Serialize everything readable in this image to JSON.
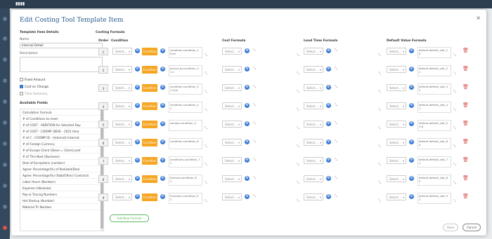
{
  "modal": {
    "title": "Edit Costing Tool Template Item",
    "close": "×",
    "footer": {
      "save": "Save",
      "cancel": "Cancel"
    }
  },
  "left": {
    "section_title": "Template Item Details",
    "name_label": "Name",
    "name_value": "Internal Detail",
    "description_label": "Description",
    "check1": "Fixed Amount",
    "check2": "Cost on Change",
    "check3": "Time Summary",
    "available_fields_title": "Available Fields",
    "fields": [
      "Calculation Formula",
      "# of Conditions to meet",
      "# of COST - ADDITION for Selected Day",
      "# of COST - COOMP. DEVE - 2021 time",
      "# of C - COOMP ID - (Internet) Internet",
      "# of Foreign Currency",
      "# of Europe Client (Slave = Client) prof",
      "# of This Next (Business)",
      "Deal of Exceptions (number)",
      "Agree: Percentage(%) of Realized/Deal",
      "Agree: Percentage(%) (Slab/Other) Contracts",
      "Labor Hours (Number)",
      "Expense (Absolute)",
      "Rep & Tracing Numbers",
      "Hot Startup (Number)",
      "Material Tri Number"
    ]
  },
  "grid": {
    "section_title": "Costing Formula",
    "headers": {
      "order": "Order",
      "condition": "Condition",
      "cost": "Cost Formula",
      "lead": "Lead Time Formula",
      "default": "Default Value Formula"
    },
    "select_placeholder": "Select...",
    "gear_glyph": "⚙",
    "resize_glyph": "⤡",
    "delete_glyph": "🗑",
    "orange_label": "Condition",
    "add_button": "Add New Formula",
    "rows": [
      {
        "order": "1",
        "cond_formula": "condition.condition_1",
        "cond2": "true",
        "def_formula": "default.default_slot_1",
        "def2": "0"
      },
      {
        "order": "2",
        "cond_formula": "priced_by.condition_2",
        "cond2": "1.1",
        "def_formula": "default.default_slot_2",
        "def2": "1"
      },
      {
        "order": "3",
        "cond_formula": "condition.condition_3",
        "cond2": "1.1(e)",
        "def_formula": "default.default_slot_3",
        "def2": "2"
      },
      {
        "order": "4",
        "cond_formula": "condition.condition_4",
        "cond2": "1",
        "def_formula": "default.default_slot_4",
        "def2": "1"
      },
      {
        "order": "5",
        "cond_formula": "sample.condition_5",
        "cond2": "",
        "def_formula": "default.default_slot_5",
        "def2": "1.6"
      },
      {
        "order": "6",
        "cond_formula": "condition.condition_6",
        "cond2": "",
        "def_formula": "default.default_slot_6",
        "def2": "4"
      },
      {
        "order": "7",
        "cond_formula": "conditions.condition_7",
        "cond2": "1",
        "def_formula": "default.default_slot_7",
        "def2": "1"
      },
      {
        "order": "8",
        "cond_formula": "formula.condition_8",
        "cond2": "1",
        "def_formula": "default.default_slot_8",
        "def2": "2"
      },
      {
        "order": "9",
        "cond_formula": "functions.condition_9",
        "cond2": "1",
        "def_formula": "default.default_slot_9",
        "def2": "1"
      }
    ]
  },
  "colors": {
    "accent": "#3a7bd5",
    "orange": "#f5a623",
    "danger": "#d9534f",
    "success": "#5cb85c"
  }
}
